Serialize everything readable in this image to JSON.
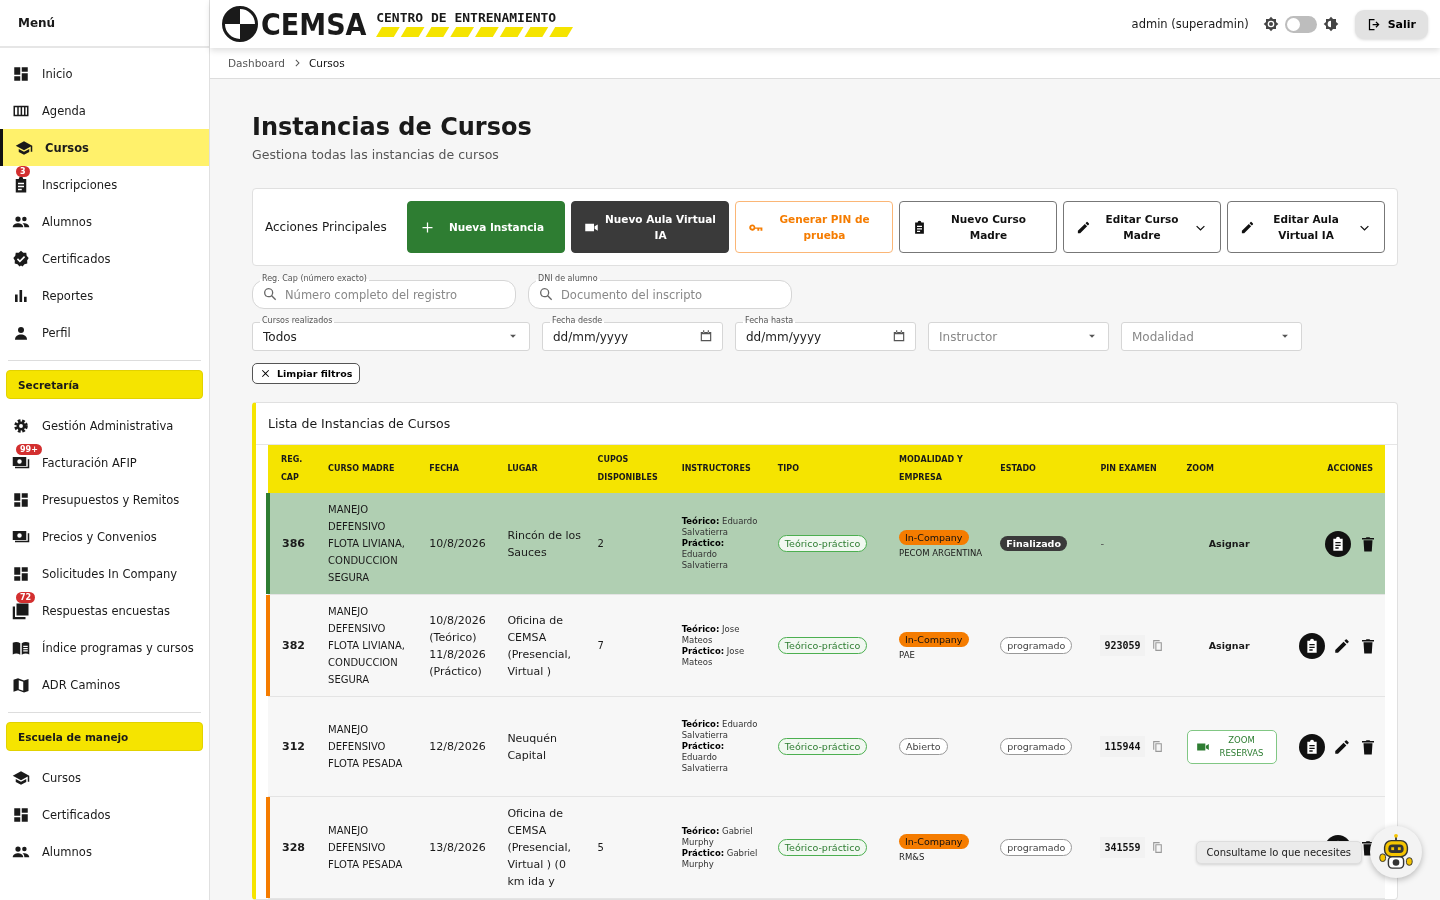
{
  "sidebar": {
    "title": "Menú",
    "sections": [
      {
        "items": [
          {
            "label": "Inicio",
            "selected": false
          },
          {
            "label": "Agenda",
            "selected": false
          },
          {
            "label": "Cursos",
            "selected": true
          },
          {
            "label": "Inscripciones",
            "selected": false,
            "badge": "3"
          },
          {
            "label": "Alumnos",
            "selected": false
          },
          {
            "label": "Certificados",
            "selected": false
          },
          {
            "label": "Reportes",
            "selected": false
          },
          {
            "label": "Perfil",
            "selected": false
          }
        ]
      },
      {
        "title": "Secretaría",
        "items": [
          {
            "label": "Gestión Administrativa",
            "selected": false
          },
          {
            "label": "Facturación AFIP",
            "selected": false,
            "badge": "99+"
          },
          {
            "label": "Presupuestos y Remitos",
            "selected": false
          },
          {
            "label": "Precios y Convenios",
            "selected": false
          },
          {
            "label": "Solicitudes In Company",
            "selected": false
          },
          {
            "label": "Respuestas encuestas",
            "selected": false,
            "badge": "72"
          },
          {
            "label": "Índice programas y cursos",
            "selected": false
          },
          {
            "label": "ADR Caminos",
            "selected": false
          }
        ]
      },
      {
        "title": "Escuela de manejo",
        "items": [
          {
            "label": "Cursos",
            "selected": false
          },
          {
            "label": "Certificados",
            "selected": false
          },
          {
            "label": "Alumnos",
            "selected": false
          }
        ]
      }
    ]
  },
  "header": {
    "brand": "CEMSA",
    "tagline": "CENTRO DE ENTRENAMIENTO",
    "user": "admin (superadmin)",
    "dark_mode": false,
    "logout": "Salir"
  },
  "breadcrumb": [
    {
      "label": "Dashboard",
      "current": false
    },
    {
      "label": "Cursos",
      "current": true
    }
  ],
  "page": {
    "title": "Instancias de Cursos",
    "subtitle": "Gestiona todas las instancias de cursos"
  },
  "actions": {
    "label": "Acciones Principales",
    "buttons": [
      {
        "kind": "primary",
        "label": "Nueva Instancia",
        "menu": false
      },
      {
        "kind": "dark",
        "label": "Nuevo Aula Virtual IA",
        "menu": false
      },
      {
        "kind": "warning",
        "label": "Generar PIN de prueba",
        "menu": false
      },
      {
        "kind": "outline",
        "label": "Nuevo Curso Madre",
        "menu": false
      },
      {
        "kind": "outline",
        "label": "Editar Curso Madre",
        "menu": true
      },
      {
        "kind": "outline",
        "label": "Editar Aula Virtual IA",
        "menu": true
      }
    ]
  },
  "filters": [
    {
      "kind": "search",
      "label": "Reg. Cap (número exacto)",
      "placeholder": "Número completo del registro"
    },
    {
      "kind": "search",
      "label": "DNI de alumno",
      "placeholder": "Documento del inscripto"
    },
    {
      "kind": "select",
      "label": "Cursos realizados",
      "value": "Todos"
    },
    {
      "kind": "date",
      "label": "Fecha desde",
      "value": "dd/mm/yyyy"
    },
    {
      "kind": "date",
      "label": "Fecha hasta",
      "value": "dd/mm/yyyy"
    },
    {
      "kind": "select",
      "placeholder": "Instructor"
    },
    {
      "kind": "select",
      "placeholder": "Modalidad"
    }
  ],
  "clear_filters": "Limpiar filtros",
  "table": {
    "title": "Lista de Instancias de Cursos",
    "columns": [
      "REG. CAP",
      "CURSO MADRE",
      "FECHA",
      "LUGAR",
      "CUPOS DISPONIBLES",
      "INSTRUCTORES",
      "TIPO",
      "MODALIDAD Y EMPRESA",
      "ESTADO",
      "PIN EXAMEN",
      "ZOOM",
      "ACCIONES"
    ],
    "rows": [
      {
        "selected": true,
        "color": "#2e7d32",
        "reg": "386",
        "curso": "MANEJO DEFENSIVO FLOTA LIVIANA, CONDUCCION SEGURA",
        "fecha": [
          "10/8/2026"
        ],
        "lugar": "Rincón de los Sauces",
        "cupos": "2",
        "instructores": [
          "**Teórico:** Eduardo Salvatierra",
          "**Práctico:** Eduardo Salvatierra"
        ],
        "tipo": "Teórico-práctico",
        "modalidad": {
          "kind": "in_company",
          "label": "In-Company",
          "empresa": "PECOM ARGENTINA"
        },
        "estado": {
          "kind": "finalizado",
          "label": "Finalizado"
        },
        "pin": {
          "value": "-",
          "copy": false
        },
        "zoom": {
          "kind": "link",
          "label": "Asignar"
        },
        "editable": false
      },
      {
        "selected": false,
        "color": "#f57c00",
        "reg": "382",
        "curso": "MANEJO DEFENSIVO FLOTA LIVIANA, CONDUCCION SEGURA",
        "fecha": [
          "10/8/2026 (Teórico)",
          "11/8/2026 (Práctico)"
        ],
        "lugar": "Oficina de CEMSA (Presencial, Virtual )",
        "cupos": "7",
        "instructores": [
          "**Teórico:** Jose Mateos",
          "**Práctico:** Jose Mateos"
        ],
        "tipo": "Teórico-práctico",
        "modalidad": {
          "kind": "in_company",
          "label": "In-Company",
          "empresa": "PAE"
        },
        "estado": {
          "kind": "programado",
          "label": "programado"
        },
        "pin": {
          "value": "923059",
          "copy": true
        },
        "zoom": {
          "kind": "link",
          "label": "Asignar"
        },
        "editable": true
      },
      {
        "selected": false,
        "reg": "312",
        "curso": "MANEJO DEFENSIVO FLOTA PESADA",
        "fecha": [
          "12/8/2026"
        ],
        "lugar": "Neuquén Capital",
        "instructores": [
          "**Teórico:** Eduardo Salvatierra",
          "**Práctico:** Eduardo Salvatierra"
        ],
        "tipo": "Teórico-práctico",
        "modalidad": {
          "kind": "abierto",
          "label": "Abierto"
        },
        "estado": {
          "kind": "programado",
          "label": "programado"
        },
        "pin": {
          "value": "115944",
          "copy": true
        },
        "zoom": {
          "kind": "button",
          "label": "ZOOM RESERVAS"
        },
        "editable": true
      },
      {
        "selected": false,
        "color": "#f57c00",
        "reg": "328",
        "curso": "MANEJO DEFENSIVO FLOTA PESADA",
        "fecha": [
          "13/8/2026"
        ],
        "lugar": "Oficina de CEMSA (Presencial, Virtual ) (0 km ida y",
        "cupos": "5",
        "instructores": [
          "**Teórico:** Gabriel Murphy",
          "**Práctico:** Gabriel Murphy"
        ],
        "tipo": "Teórico-práctico",
        "modalidad": {
          "kind": "in_company",
          "label": "In-Company",
          "empresa": "RM&S"
        },
        "estado": {
          "kind": "programado",
          "label": "programado"
        },
        "pin": {
          "value": "341559",
          "copy": true
        },
        "editable": false
      }
    ]
  },
  "assistant": {
    "tooltip": "Consultame lo que necesites"
  }
}
